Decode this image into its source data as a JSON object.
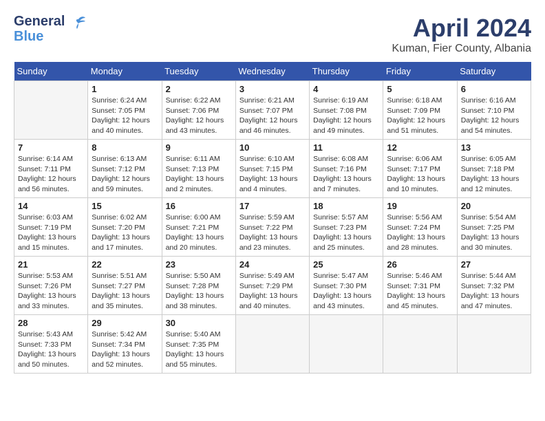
{
  "header": {
    "logo_general": "General",
    "logo_blue": "Blue",
    "month_title": "April 2024",
    "location": "Kuman, Fier County, Albania"
  },
  "weekdays": [
    "Sunday",
    "Monday",
    "Tuesday",
    "Wednesday",
    "Thursday",
    "Friday",
    "Saturday"
  ],
  "weeks": [
    [
      {
        "day": "",
        "info": ""
      },
      {
        "day": "1",
        "info": "Sunrise: 6:24 AM\nSunset: 7:05 PM\nDaylight: 12 hours\nand 40 minutes."
      },
      {
        "day": "2",
        "info": "Sunrise: 6:22 AM\nSunset: 7:06 PM\nDaylight: 12 hours\nand 43 minutes."
      },
      {
        "day": "3",
        "info": "Sunrise: 6:21 AM\nSunset: 7:07 PM\nDaylight: 12 hours\nand 46 minutes."
      },
      {
        "day": "4",
        "info": "Sunrise: 6:19 AM\nSunset: 7:08 PM\nDaylight: 12 hours\nand 49 minutes."
      },
      {
        "day": "5",
        "info": "Sunrise: 6:18 AM\nSunset: 7:09 PM\nDaylight: 12 hours\nand 51 minutes."
      },
      {
        "day": "6",
        "info": "Sunrise: 6:16 AM\nSunset: 7:10 PM\nDaylight: 12 hours\nand 54 minutes."
      }
    ],
    [
      {
        "day": "7",
        "info": "Sunrise: 6:14 AM\nSunset: 7:11 PM\nDaylight: 12 hours\nand 56 minutes."
      },
      {
        "day": "8",
        "info": "Sunrise: 6:13 AM\nSunset: 7:12 PM\nDaylight: 12 hours\nand 59 minutes."
      },
      {
        "day": "9",
        "info": "Sunrise: 6:11 AM\nSunset: 7:13 PM\nDaylight: 13 hours\nand 2 minutes."
      },
      {
        "day": "10",
        "info": "Sunrise: 6:10 AM\nSunset: 7:15 PM\nDaylight: 13 hours\nand 4 minutes."
      },
      {
        "day": "11",
        "info": "Sunrise: 6:08 AM\nSunset: 7:16 PM\nDaylight: 13 hours\nand 7 minutes."
      },
      {
        "day": "12",
        "info": "Sunrise: 6:06 AM\nSunset: 7:17 PM\nDaylight: 13 hours\nand 10 minutes."
      },
      {
        "day": "13",
        "info": "Sunrise: 6:05 AM\nSunset: 7:18 PM\nDaylight: 13 hours\nand 12 minutes."
      }
    ],
    [
      {
        "day": "14",
        "info": "Sunrise: 6:03 AM\nSunset: 7:19 PM\nDaylight: 13 hours\nand 15 minutes."
      },
      {
        "day": "15",
        "info": "Sunrise: 6:02 AM\nSunset: 7:20 PM\nDaylight: 13 hours\nand 17 minutes."
      },
      {
        "day": "16",
        "info": "Sunrise: 6:00 AM\nSunset: 7:21 PM\nDaylight: 13 hours\nand 20 minutes."
      },
      {
        "day": "17",
        "info": "Sunrise: 5:59 AM\nSunset: 7:22 PM\nDaylight: 13 hours\nand 23 minutes."
      },
      {
        "day": "18",
        "info": "Sunrise: 5:57 AM\nSunset: 7:23 PM\nDaylight: 13 hours\nand 25 minutes."
      },
      {
        "day": "19",
        "info": "Sunrise: 5:56 AM\nSunset: 7:24 PM\nDaylight: 13 hours\nand 28 minutes."
      },
      {
        "day": "20",
        "info": "Sunrise: 5:54 AM\nSunset: 7:25 PM\nDaylight: 13 hours\nand 30 minutes."
      }
    ],
    [
      {
        "day": "21",
        "info": "Sunrise: 5:53 AM\nSunset: 7:26 PM\nDaylight: 13 hours\nand 33 minutes."
      },
      {
        "day": "22",
        "info": "Sunrise: 5:51 AM\nSunset: 7:27 PM\nDaylight: 13 hours\nand 35 minutes."
      },
      {
        "day": "23",
        "info": "Sunrise: 5:50 AM\nSunset: 7:28 PM\nDaylight: 13 hours\nand 38 minutes."
      },
      {
        "day": "24",
        "info": "Sunrise: 5:49 AM\nSunset: 7:29 PM\nDaylight: 13 hours\nand 40 minutes."
      },
      {
        "day": "25",
        "info": "Sunrise: 5:47 AM\nSunset: 7:30 PM\nDaylight: 13 hours\nand 43 minutes."
      },
      {
        "day": "26",
        "info": "Sunrise: 5:46 AM\nSunset: 7:31 PM\nDaylight: 13 hours\nand 45 minutes."
      },
      {
        "day": "27",
        "info": "Sunrise: 5:44 AM\nSunset: 7:32 PM\nDaylight: 13 hours\nand 47 minutes."
      }
    ],
    [
      {
        "day": "28",
        "info": "Sunrise: 5:43 AM\nSunset: 7:33 PM\nDaylight: 13 hours\nand 50 minutes."
      },
      {
        "day": "29",
        "info": "Sunrise: 5:42 AM\nSunset: 7:34 PM\nDaylight: 13 hours\nand 52 minutes."
      },
      {
        "day": "30",
        "info": "Sunrise: 5:40 AM\nSunset: 7:35 PM\nDaylight: 13 hours\nand 55 minutes."
      },
      {
        "day": "",
        "info": ""
      },
      {
        "day": "",
        "info": ""
      },
      {
        "day": "",
        "info": ""
      },
      {
        "day": "",
        "info": ""
      }
    ]
  ]
}
